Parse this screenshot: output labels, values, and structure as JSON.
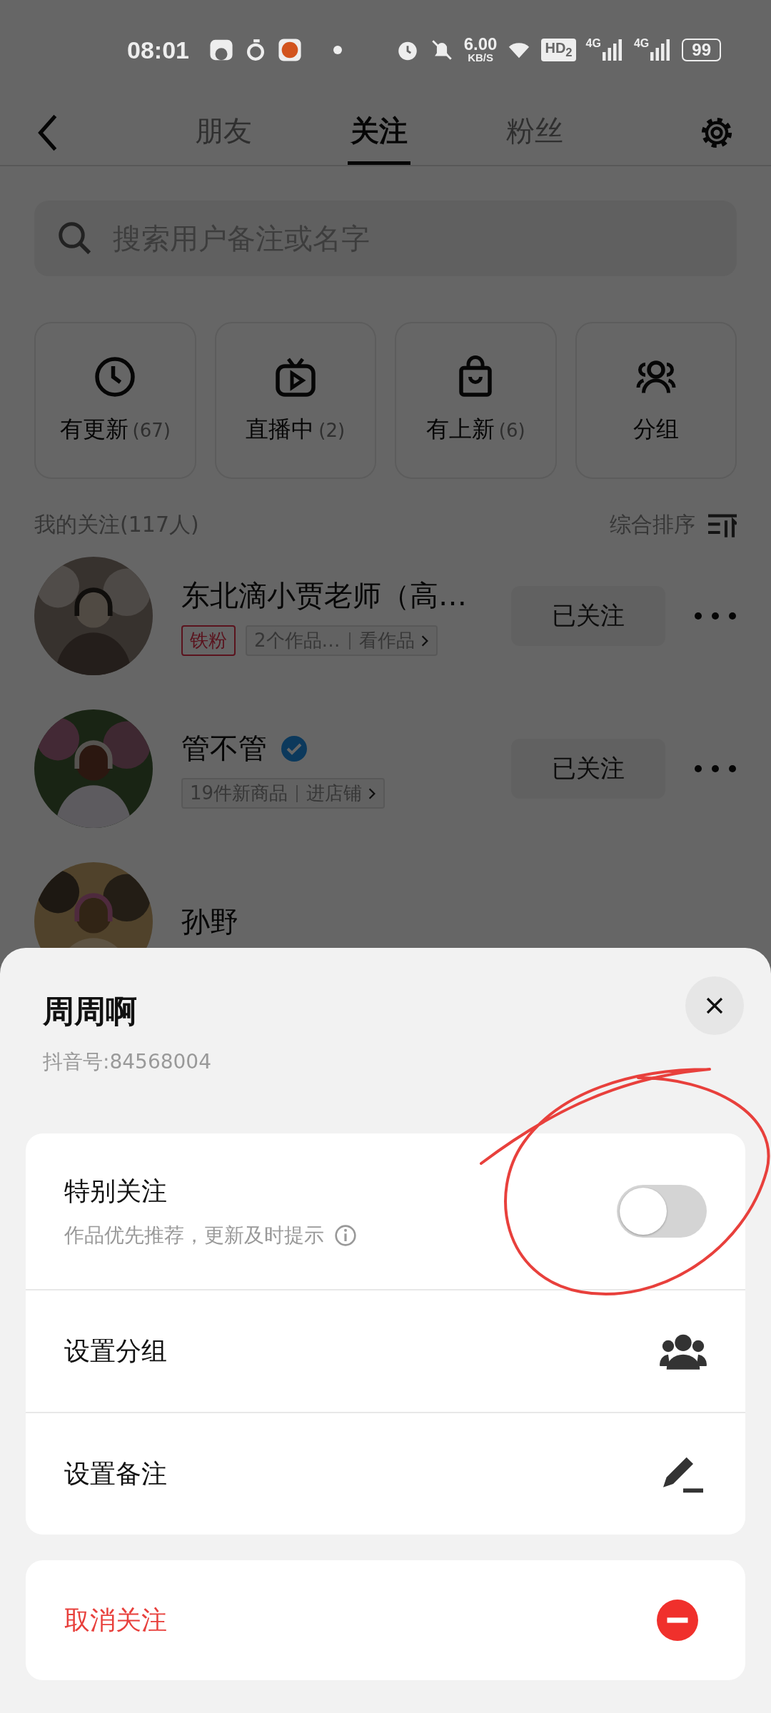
{
  "status_bar": {
    "time": "08:01",
    "speed": "6.00",
    "speed_unit": "KB/S",
    "hd": "HD$_{2}$",
    "networks": [
      "4G",
      "4G"
    ],
    "battery": "99"
  },
  "tabs": [
    {
      "label": "朋友",
      "selected": false
    },
    {
      "label": "关注",
      "selected": true
    },
    {
      "label": "粉丝",
      "selected": false
    }
  ],
  "search": {
    "placeholder": "搜索用户备注或名字"
  },
  "shortcuts": [
    {
      "kind": "clock",
      "label": "有更新",
      "count": "(67)"
    },
    {
      "kind": "tv",
      "label": "直播中",
      "count": "(2)"
    },
    {
      "kind": "bag",
      "label": "有上新",
      "count": "(6)"
    },
    {
      "kind": "group",
      "label": "分组"
    }
  ],
  "following_header": {
    "title": "我的关注(117人)",
    "sort": "综合排序"
  },
  "following": [
    {
      "name": "东北滴小贾老师（高…",
      "verified": false,
      "tag": "铁粉",
      "info": "2个作品…",
      "link": "看作品",
      "button": "已关注"
    },
    {
      "name": "管不管",
      "verified": true,
      "info": "19件新商品",
      "link": "进店铺",
      "button": "已关注"
    },
    {
      "name": "孙野",
      "verified": false
    }
  ],
  "sheet": {
    "title": "周周啊",
    "subtitle": "抖音号:84568004",
    "items": [
      {
        "kind": "toggle",
        "label": "特别关注",
        "description": "作品优先推荐，更新及时提示",
        "on": false
      },
      {
        "kind": "group",
        "label": "设置分组"
      },
      {
        "kind": "edit",
        "label": "设置备注"
      }
    ],
    "danger": {
      "label": "取消关注"
    }
  }
}
